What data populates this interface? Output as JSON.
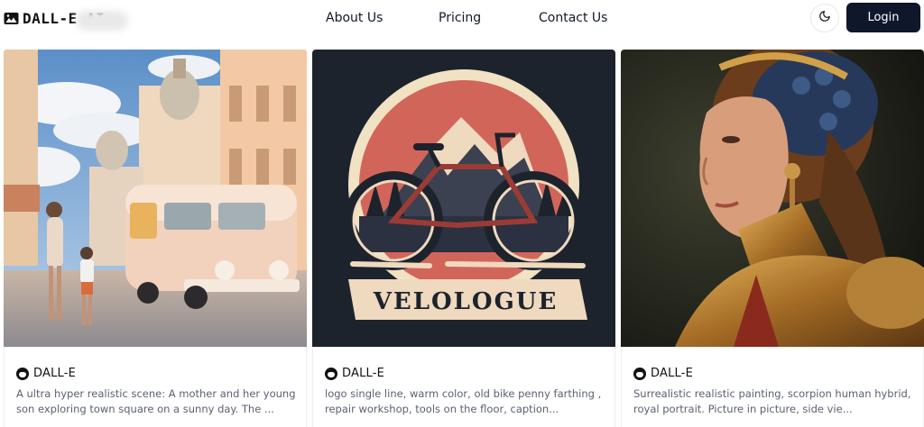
{
  "header": {
    "logo_text": "DALL-E AI",
    "nav": [
      "About Us",
      "Pricing",
      "Contact Us"
    ],
    "login_label": "Login",
    "theme_icon": "moon-icon"
  },
  "cards": [
    {
      "author": "DALL-E",
      "description": "A ultra hyper realistic scene: A mother and her young son exploring town square on a sunny day. The ..."
    },
    {
      "author": "DALL-E",
      "description": "logo single line, warm color, old bike penny farthing , repair workshop, tools on the floor, caption...",
      "image_text": "VELOLOGUE"
    },
    {
      "author": "DALL-E",
      "description": "Surrealistic realistic painting, scorpion human hybrid, royal portrait. Picture in picture, side vie..."
    }
  ],
  "colors": {
    "login_bg": "#0f172a",
    "text": "#111827",
    "muted_text": "#5b6170"
  }
}
